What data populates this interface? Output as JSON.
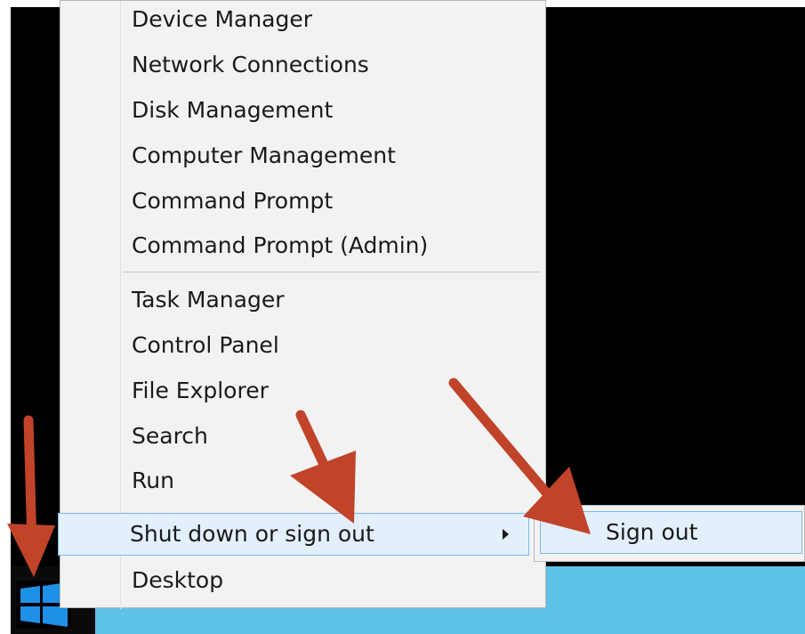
{
  "context_menu": {
    "items": [
      {
        "label": "Device Manager"
      },
      {
        "label": "Network Connections"
      },
      {
        "label": "Disk Management"
      },
      {
        "label": "Computer Management"
      },
      {
        "label": "Command Prompt"
      },
      {
        "label": "Command Prompt (Admin)"
      },
      {
        "label": "Task Manager"
      },
      {
        "label": "Control Panel"
      },
      {
        "label": "File Explorer"
      },
      {
        "label": "Search"
      },
      {
        "label": "Run"
      },
      {
        "label": "Shut down or sign out",
        "highlighted": true,
        "has_submenu": true
      },
      {
        "label": "Desktop"
      }
    ]
  },
  "submenu": {
    "items": [
      {
        "label": "Sign out",
        "highlighted": true
      }
    ]
  },
  "colors": {
    "menu_background": "#f2f2f2",
    "highlight_background": "#e3effb",
    "highlight_border": "#7ab8e8",
    "desktop_background": "#000000",
    "start_strip": "#5fc2e7",
    "windows_logo": "#1e90e6",
    "annotation_arrow": "#c0432a"
  },
  "icons": {
    "start_button": "windows-logo-icon",
    "submenu_indicator": "chevron-right-icon",
    "annotation": "red-arrow-icon"
  }
}
